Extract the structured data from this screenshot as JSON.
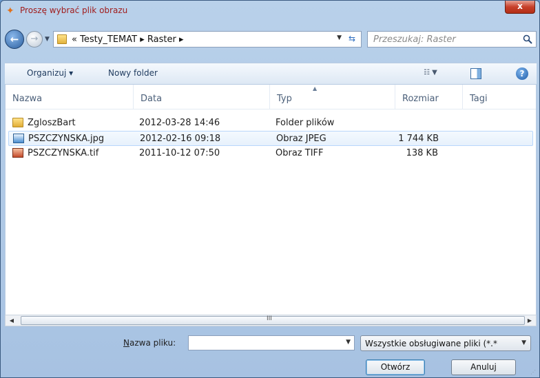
{
  "window": {
    "title": "Proszę wybrać plik obrazu",
    "close_label": "x"
  },
  "nav": {
    "breadcrumbs": [
      "« Testy_TEMAT",
      "▸",
      "Raster",
      "▸"
    ],
    "search_placeholder": "Przeszukaj: Raster"
  },
  "toolbar": {
    "organize_label": "Organizuj ▾",
    "new_folder_label": "Nowy folder"
  },
  "columns": [
    "Nazwa",
    "Data",
    "Typ",
    "Rozmiar",
    "Tagi"
  ],
  "files": [
    {
      "name": "ZgloszBart",
      "date": "2012-03-28 14:46",
      "type": "Folder plików",
      "size": "",
      "icon": "folder-icon"
    },
    {
      "name": "PSZCZYNSKA.jpg",
      "date": "2012-02-16 09:18",
      "type": "Obraz JPEG",
      "size": "1 744 KB",
      "icon": "jpeg-image-icon"
    },
    {
      "name": "PSZCZYNSKA.tif",
      "date": "2011-10-12 07:50",
      "type": "Obraz TIFF",
      "size": "138 KB",
      "icon": "tiff-image-icon"
    }
  ],
  "scrollbar": {
    "grip": "III"
  },
  "bottom": {
    "filename_label": "Nazwa pliku:",
    "filename_value": "",
    "filter_text": "Wszystkie obsługiwane pliki (*.*",
    "open_label": "Otwórz",
    "cancel_label": "Anuluj"
  },
  "colors": {
    "title_text": "#a01c1c",
    "window_frame": "#b9d1ea",
    "accent": "#2c6dbf"
  }
}
